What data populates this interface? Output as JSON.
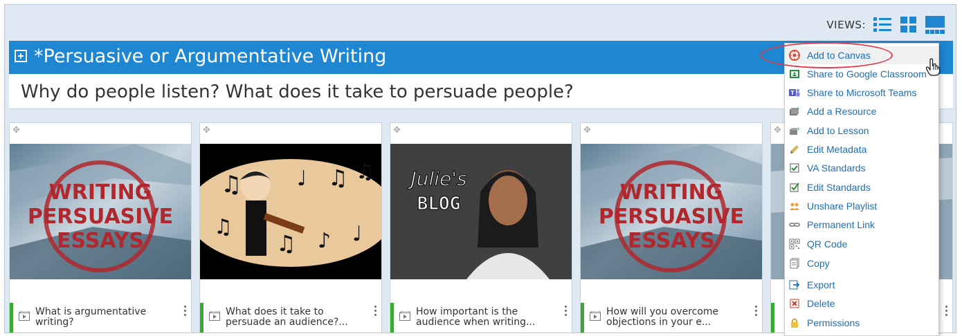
{
  "views": {
    "label": "VIEWS:",
    "icons": [
      "list-view-icon",
      "grid-view-icon",
      "tile-view-icon"
    ]
  },
  "playlist": {
    "title": "*Persuasive or Argumentative Writing",
    "question": "Why do people listen? What does it take to persuade people?"
  },
  "cards": [
    {
      "title_line1": "What is argumentative",
      "title_line2": "writing?",
      "thumb_text": [
        "WRITING",
        "PERSUASIVE",
        "ESSAYS"
      ]
    },
    {
      "title_line1": "What does it take to",
      "title_line2": "persuade an audience?..."
    },
    {
      "title_line1": "How important is the",
      "title_line2": "audience when writing...",
      "thumb_text": [
        "Julie's",
        "BLOG"
      ]
    },
    {
      "title_line1": "How will you overcome",
      "title_line2": "objections in your e...",
      "thumb_text": [
        "WRITING",
        "PERSUASIVE",
        "ESSAYS"
      ]
    }
  ],
  "menu": {
    "items": [
      {
        "label": "Add to Canvas",
        "icon": "canvas-icon"
      },
      {
        "label": "Share to Google Classroom",
        "icon": "google-classroom-icon"
      },
      {
        "label": "Share to Microsoft Teams",
        "icon": "microsoft-teams-icon"
      },
      {
        "label": "Add a Resource",
        "icon": "add-resource-icon"
      },
      {
        "label": "Add to Lesson",
        "icon": "add-lesson-icon"
      },
      {
        "label": "Edit Metadata",
        "icon": "pencil-icon"
      },
      {
        "label": "VA Standards",
        "icon": "checkbox-icon"
      },
      {
        "label": "Edit Standards",
        "icon": "edit-checkbox-icon"
      },
      {
        "label": "Unshare Playlist",
        "icon": "people-icon"
      },
      {
        "label": "Permanent Link",
        "icon": "link-icon"
      },
      {
        "label": "QR Code",
        "icon": "qr-code-icon"
      },
      {
        "label": "Copy",
        "icon": "copy-icon"
      },
      {
        "label": "Export",
        "icon": "export-icon"
      },
      {
        "label": "Delete",
        "icon": "delete-icon"
      },
      {
        "label": "Permissions",
        "icon": "lock-icon"
      }
    ]
  },
  "colors": {
    "title_bar": "#1f86d2",
    "background": "#dfe9f3",
    "card_accent": "#3aaa35",
    "menu_link": "#1c6fb5",
    "highlight": "#e23b4b"
  }
}
